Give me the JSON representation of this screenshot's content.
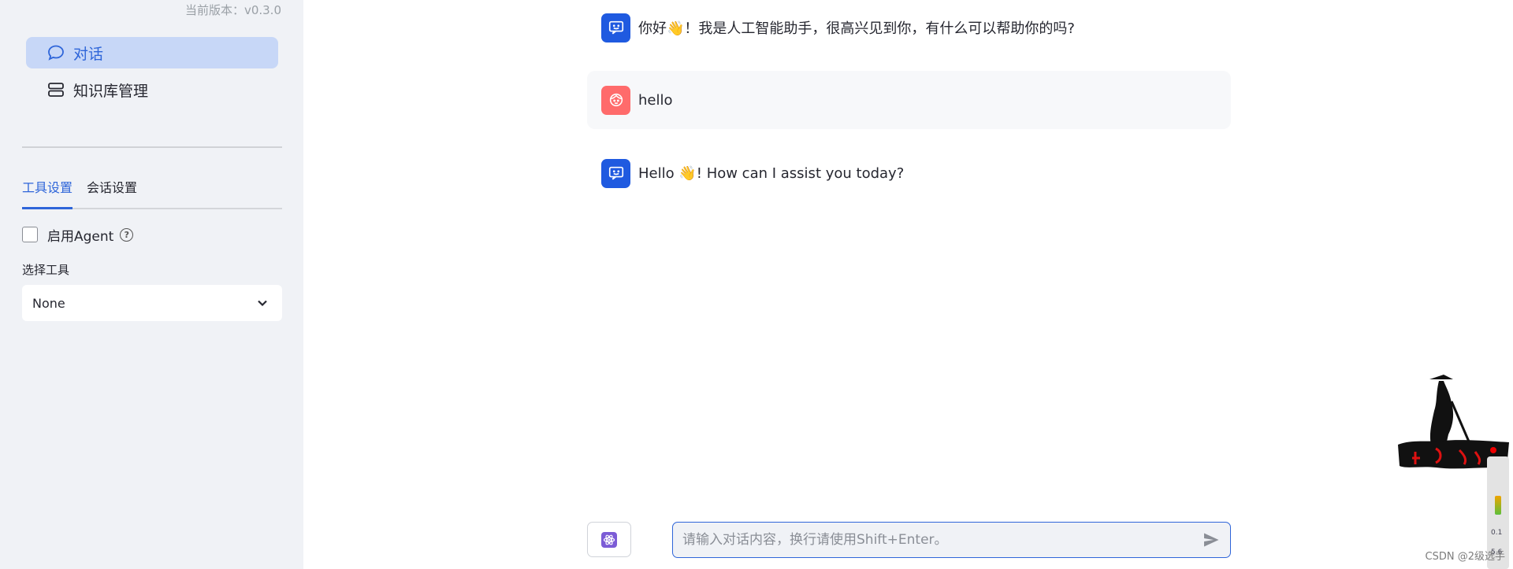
{
  "sidebar": {
    "version": "当前版本：v0.3.0",
    "nav": [
      {
        "label": "对话",
        "icon": "chat-bubble-icon"
      },
      {
        "label": "知识库管理",
        "icon": "database-icon"
      }
    ],
    "tabs": [
      "工具设置",
      "会话设置"
    ],
    "agent_label": "启用Agent",
    "tool_label": "选择工具",
    "tool_select_value": "None"
  },
  "chat": {
    "messages": [
      {
        "role": "assistant",
        "text": "你好👋！我是人工智能助手，很高兴见到你，有什么可以帮助你的吗?"
      },
      {
        "role": "user",
        "text": "hello"
      },
      {
        "role": "assistant",
        "text": "Hello 👋! How can I assist you today?"
      }
    ],
    "input_placeholder": "请输入对话内容，换行请使用Shift+Enter。"
  },
  "overlay": {
    "watermark": "CSDN @2级选手",
    "net_up": "0.1",
    "net_down": "5.6"
  },
  "colors": {
    "accent": "#2e65d9",
    "bot_avatar": "#1f5ae0",
    "user_avatar": "#ff6b6b",
    "sidebar_bg": "#f0f2f6"
  }
}
